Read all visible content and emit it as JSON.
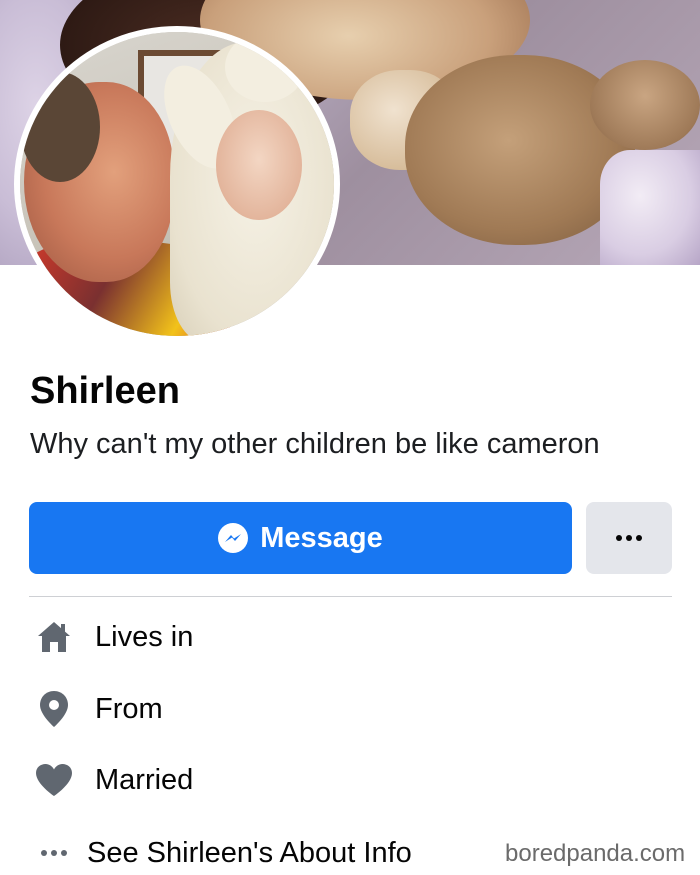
{
  "profile": {
    "name": "Shirleen",
    "bio": "Why can't my other children be like cameron"
  },
  "actions": {
    "message_label": "Message"
  },
  "info": [
    {
      "icon": "home-icon",
      "label": "Lives in"
    },
    {
      "icon": "location-pin-icon",
      "label": "From"
    },
    {
      "icon": "heart-icon",
      "label": "Married"
    },
    {
      "icon": "more-dots-icon",
      "label": "See Shirleen's About Info"
    }
  ],
  "watermark": "boredpanda.com",
  "colors": {
    "accent": "#1877f2",
    "secondary_button": "#e4e6eb",
    "icon_gray": "#606770"
  }
}
